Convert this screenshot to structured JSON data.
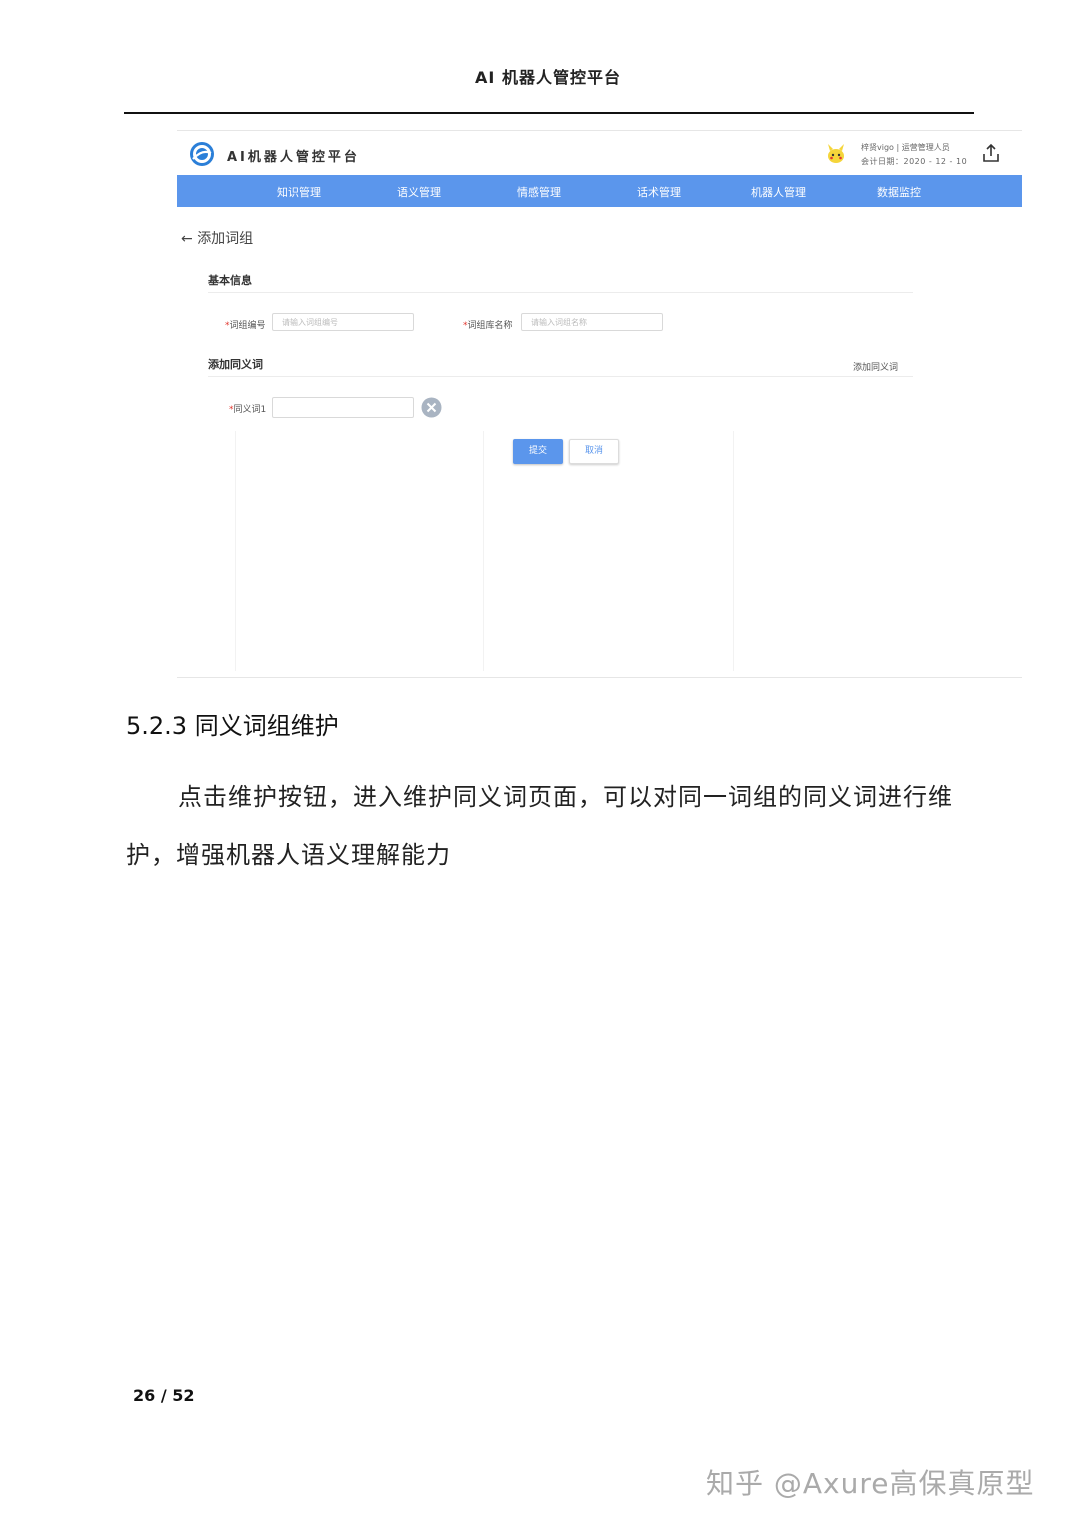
{
  "document": {
    "running_header": "AI 机器人管控平台",
    "section_heading": "5.2.3 同义词组维护",
    "paragraph": "点击维护按钮，进入维护同义词页面，可以对同一词组的同义词进行维护，增强机器人语义理解能力",
    "page_number": "26 / 52",
    "watermark": "知乎 @Axure高保真原型"
  },
  "app": {
    "title": "AI机器人管控平台",
    "user": {
      "name_role": "梓贤vigo | 运营管理人员",
      "date": "会计日期：2020 - 12 - 10"
    },
    "icons": {
      "logo": "platform-logo-icon",
      "avatar": "pikachu-avatar-icon",
      "upload": "share-upload-icon",
      "back": "arrow-left-icon",
      "remove": "close-circle-icon"
    },
    "colors": {
      "nav_bg": "#5b96ec",
      "primary": "#5b96ec",
      "required": "#e2372f"
    },
    "nav": [
      "知识管理",
      "语义管理",
      "情感管理",
      "话术管理",
      "机器人管理",
      "数据监控"
    ],
    "page_title": "添加词组",
    "basic_info": {
      "title": "基本信息",
      "group_id_label": "词组编号",
      "group_id_placeholder": "请输入词组编号",
      "group_name_label": "词组库名称",
      "group_name_placeholder": "请输入词组名称"
    },
    "synonyms": {
      "title": "添加同义词",
      "add_link": "添加同义词",
      "item_label": "同义词1",
      "item_value": ""
    },
    "buttons": {
      "submit": "提交",
      "cancel": "取消"
    }
  }
}
